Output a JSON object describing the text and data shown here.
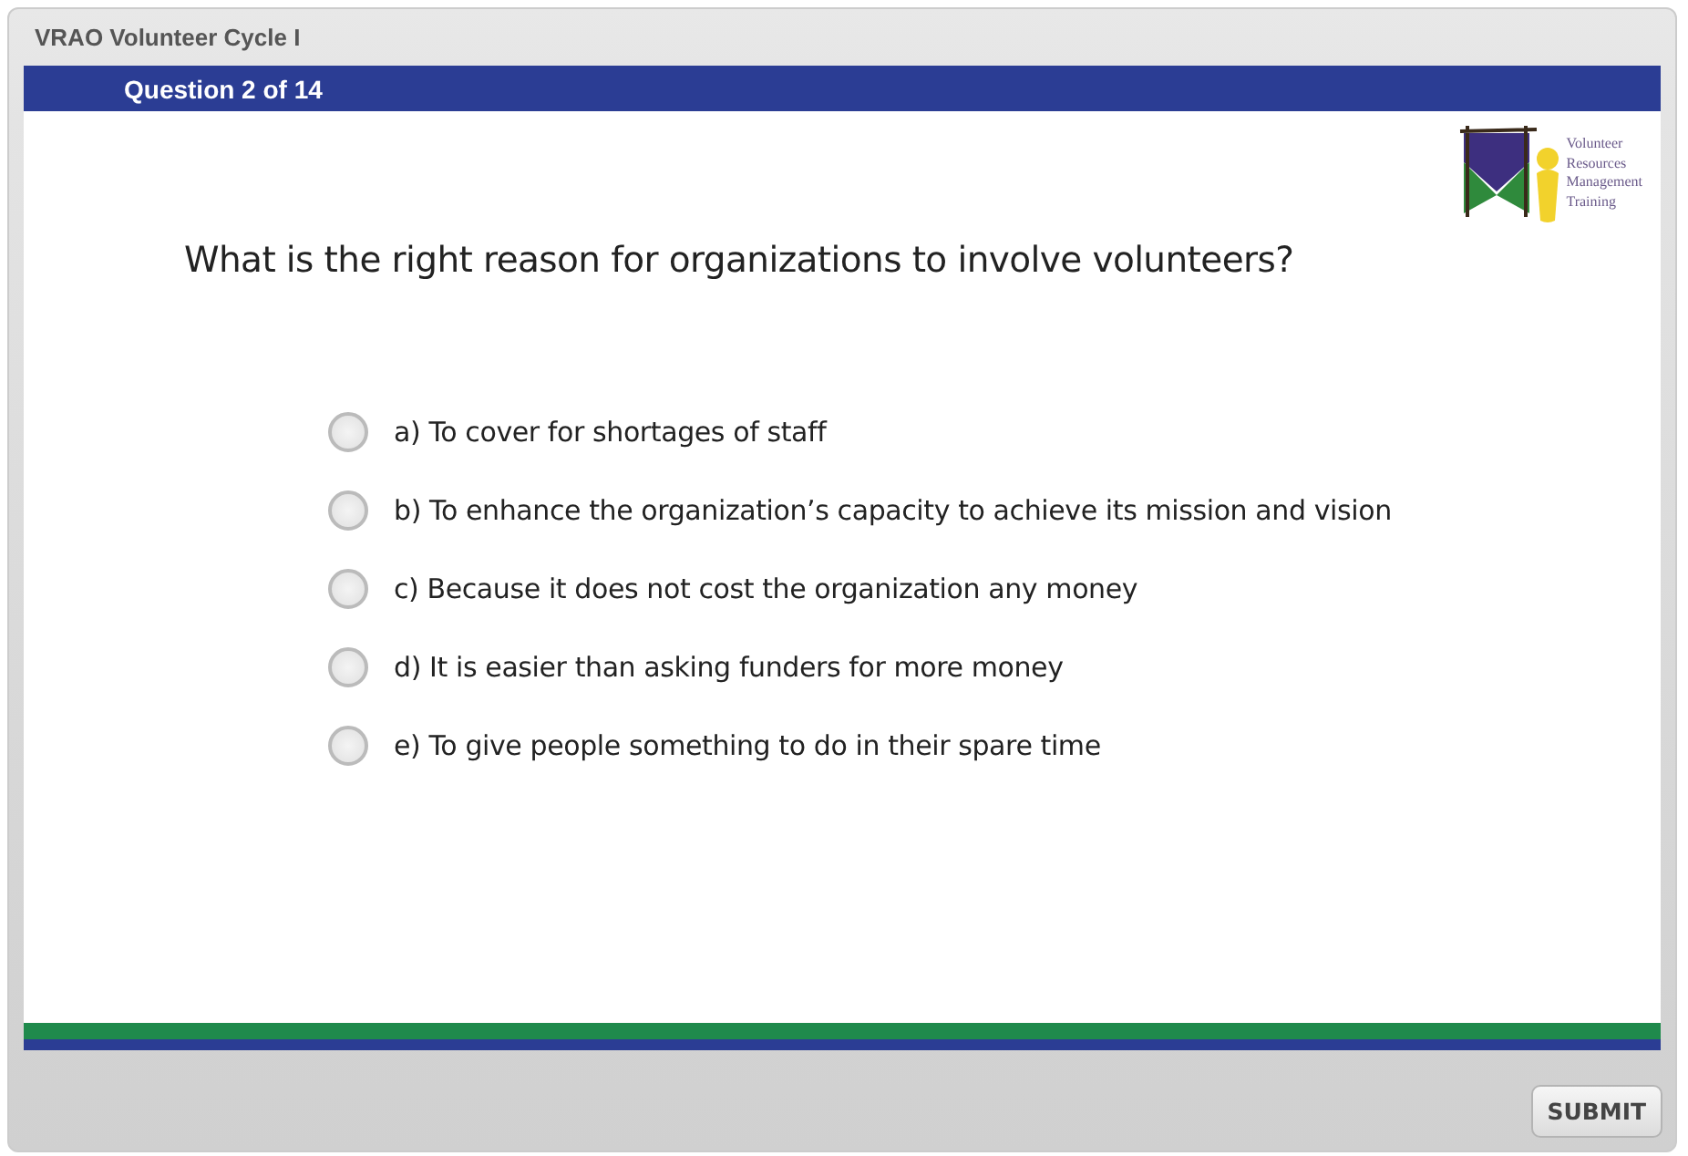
{
  "window": {
    "title": "VRAO Volunteer Cycle I"
  },
  "header": {
    "progress": "Question 2 of 14"
  },
  "logo": {
    "lines": [
      "Volunteer",
      "Resources",
      "Management",
      "Training"
    ]
  },
  "question": "What is the right reason for organizations to involve volunteers?",
  "options": [
    {
      "label": "a) To cover for shortages of staff",
      "selected": false
    },
    {
      "label": "b) To enhance the organization’s capacity to achieve its mission and vision",
      "selected": false
    },
    {
      "label": "c) Because it does not cost the organization any money",
      "selected": false
    },
    {
      "label": "d) It is easier than asking funders for more money",
      "selected": false
    },
    {
      "label": "e) To give people something to do in their spare time",
      "selected": false
    }
  ],
  "buttons": [
    {
      "label": "SUBMIT"
    }
  ]
}
